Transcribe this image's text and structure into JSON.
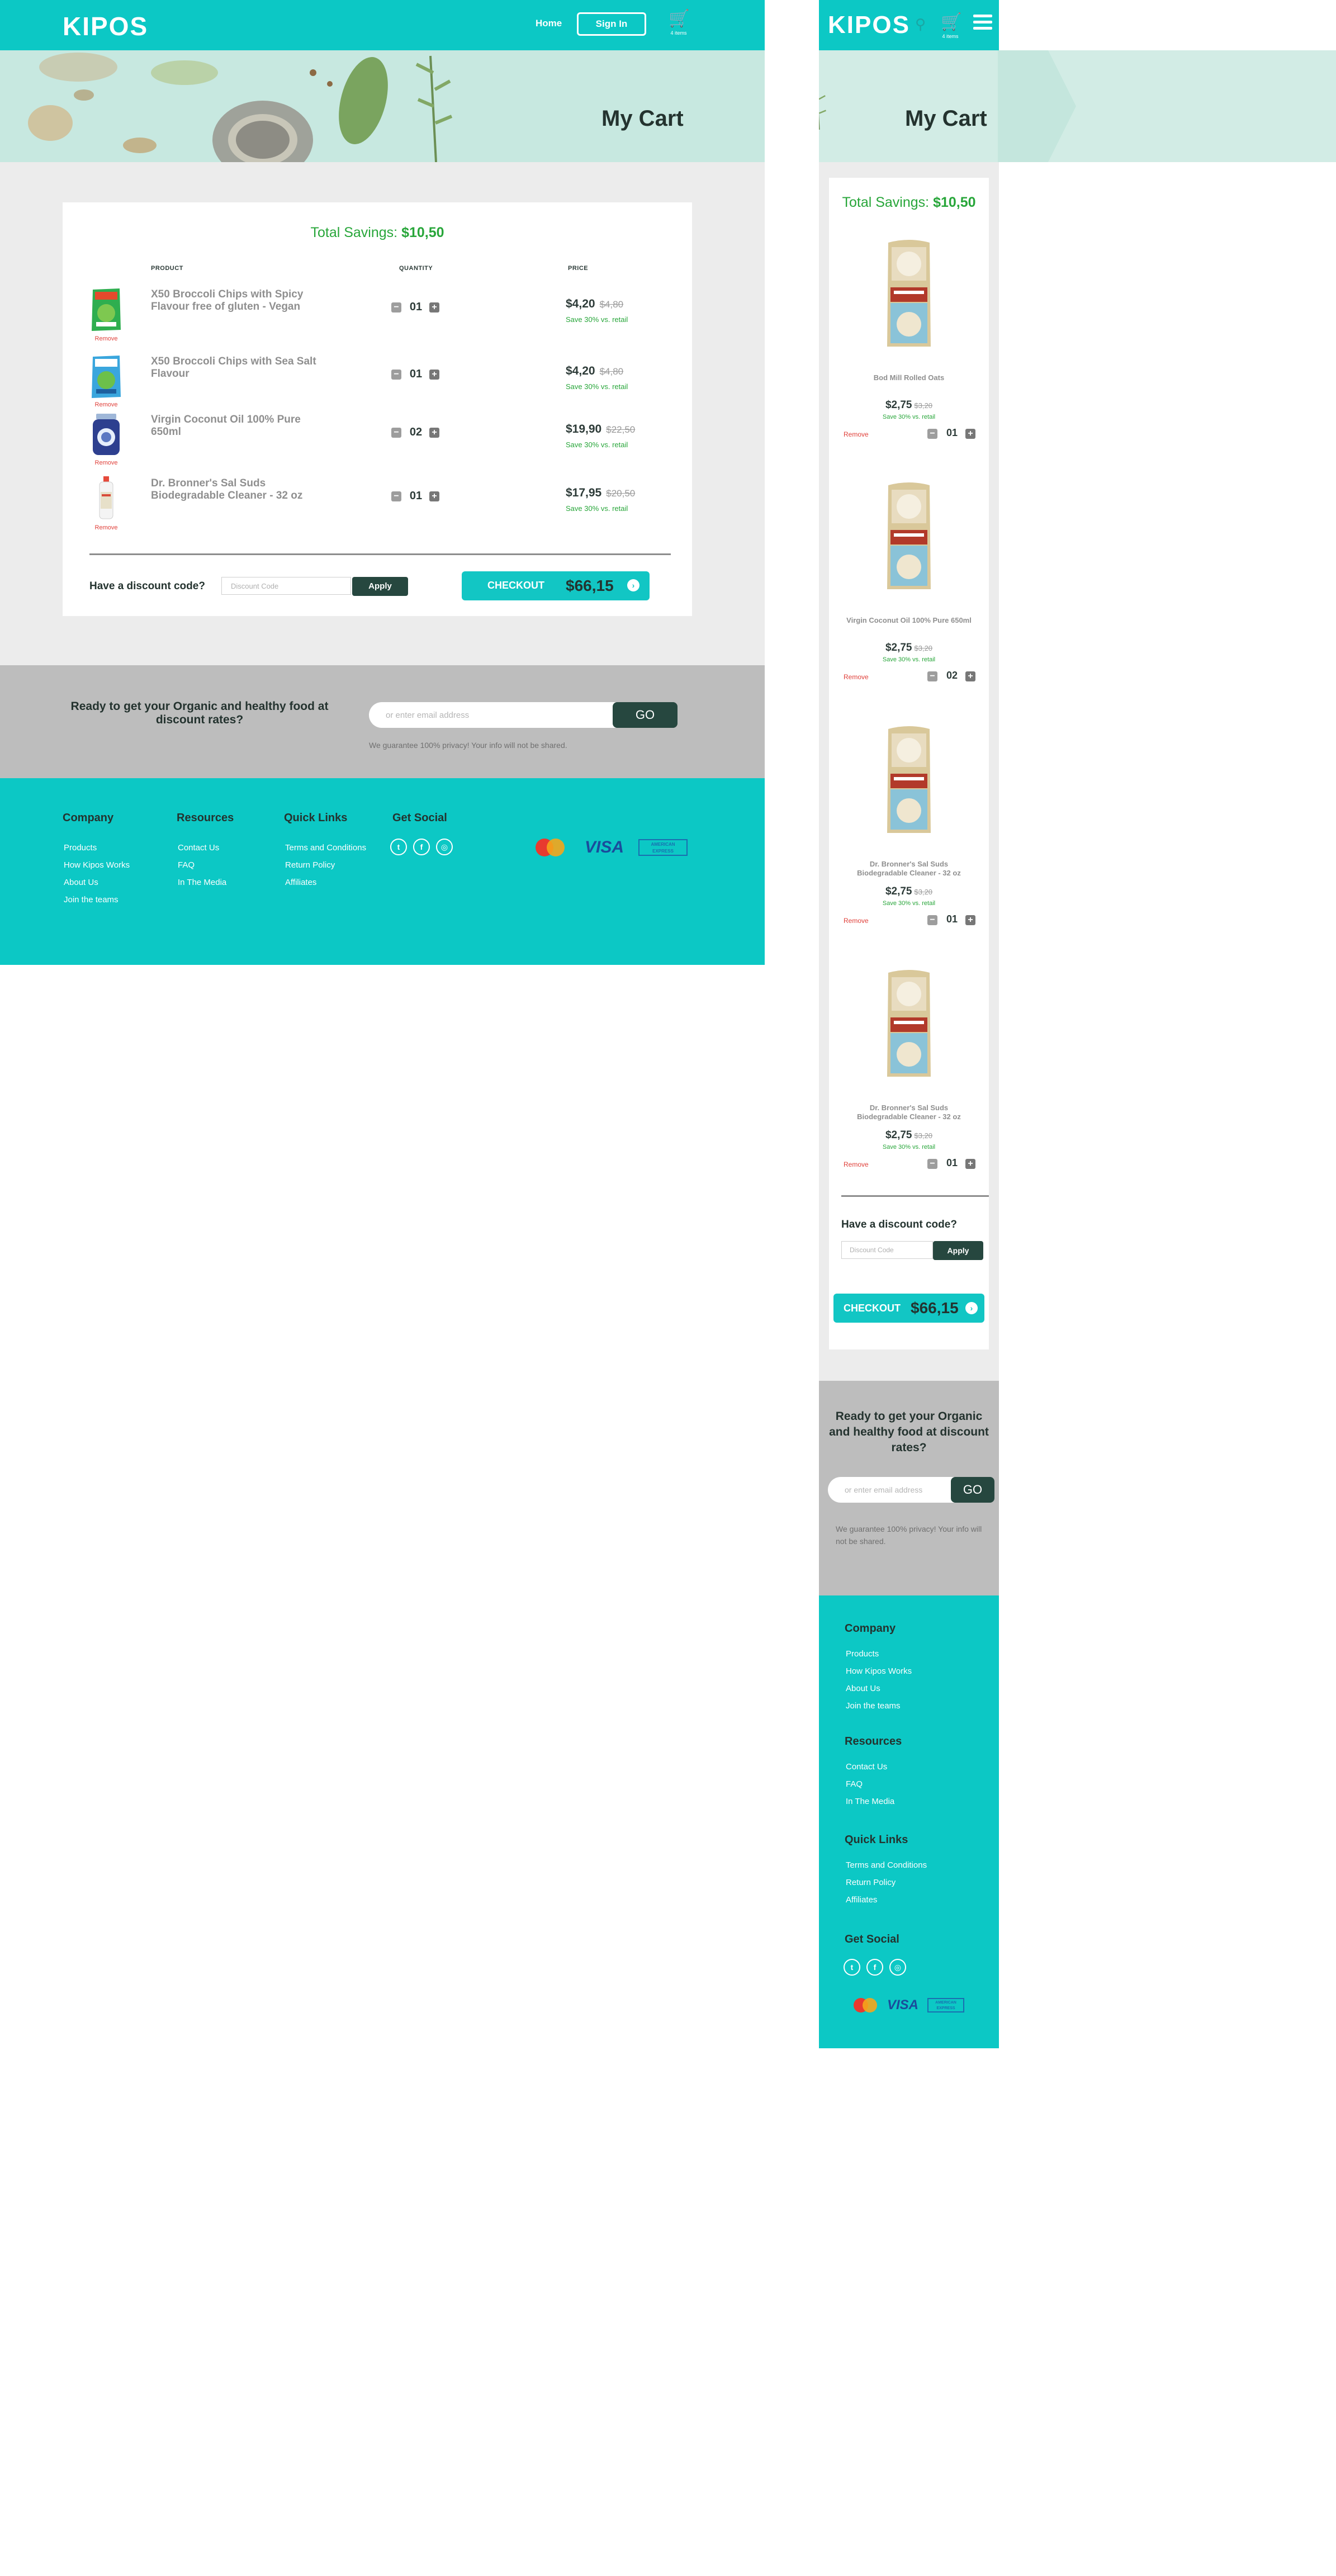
{
  "brand": {
    "logo": "KIPOS"
  },
  "header": {
    "home": "Home",
    "signin": "Sign In",
    "cart_count": "4 items"
  },
  "hero": {
    "title": "My Cart"
  },
  "cart": {
    "savings_label": "Total Savings:",
    "savings_value": "$10,50",
    "columns": {
      "product": "PRODUCT",
      "quantity": "QUANTITY",
      "price": "PRICE"
    },
    "remove_label": "Remove",
    "items": [
      {
        "name": "X50 Broccoli Chips with Spicy Flavour free of gluten - Vegan",
        "qty": "01",
        "price": "$4,20",
        "old_price": "$4,80",
        "save": "Save 30% vs. retail"
      },
      {
        "name": "X50 Broccoli Chips with Sea Salt Flavour",
        "qty": "01",
        "price": "$4,20",
        "old_price": "$4,80",
        "save": "Save 30% vs. retail"
      },
      {
        "name": "Virgin Coconut Oil 100% Pure 650ml",
        "qty": "02",
        "price": "$19,90",
        "old_price": "$22,50",
        "save": "Save 30% vs. retail"
      },
      {
        "name": "Dr. Bronner's Sal Suds Biodegradable Cleaner - 32 oz",
        "qty": "01",
        "price": "$17,95",
        "old_price": "$20,50",
        "save": "Save 30% vs. retail"
      }
    ],
    "discount_label": "Have a discount code?",
    "discount_placeholder": "Discount Code",
    "apply": "Apply",
    "checkout_label": "CHECKOUT",
    "checkout_total": "$66,15"
  },
  "mobile_cart": {
    "items": [
      {
        "name": "Bod Mill Rolled Oats",
        "qty": "01",
        "price": "$2,75",
        "old_price": "$3,20",
        "save": "Save 30% vs. retail"
      },
      {
        "name": "Virgin Coconut Oil 100% Pure 650ml",
        "qty": "02",
        "price": "$2,75",
        "old_price": "$3,20",
        "save": "Save 30% vs. retail"
      },
      {
        "name": "Dr. Bronner's Sal Suds Biodegradable Cleaner - 32 oz",
        "qty": "01",
        "price": "$2,75",
        "old_price": "$3,20",
        "save": "Save 30% vs. retail"
      },
      {
        "name": "Dr. Bronner's Sal Suds Biodegradable Cleaner - 32 oz",
        "qty": "01",
        "price": "$2,75",
        "old_price": "$3,20",
        "save": "Save 30% vs. retail"
      }
    ]
  },
  "newsletter": {
    "headline": "Ready to get your Organic and healthy food at discount rates?",
    "placeholder": "or enter email address",
    "go": "GO",
    "privacy": "We guarantee 100% privacy! Your info will not be shared."
  },
  "footer": {
    "company": {
      "title": "Company",
      "links": [
        "Products",
        "How Kipos Works",
        "About Us",
        "Join the teams"
      ]
    },
    "resources": {
      "title": "Resources",
      "links": [
        "Contact Us",
        "FAQ",
        "In The Media"
      ]
    },
    "quick_links": {
      "title": "Quick Links",
      "links": [
        "Terms and Conditions",
        "Return Policy",
        "Affiliates"
      ]
    },
    "social": {
      "title": "Get Social",
      "icons": [
        "twitter-icon",
        "facebook-icon",
        "instagram-icon"
      ]
    },
    "payments": {
      "mastercard": "MasterCard",
      "visa": "VISA",
      "amex": "AMERICAN EXPRESS"
    }
  },
  "colors": {
    "teal": "#0cc8c5",
    "dark_green": "#26473f",
    "savings_green": "#28a63a",
    "remove_red": "#e0403a",
    "band_grey": "#ececec",
    "news_grey": "#bdbdbd"
  }
}
